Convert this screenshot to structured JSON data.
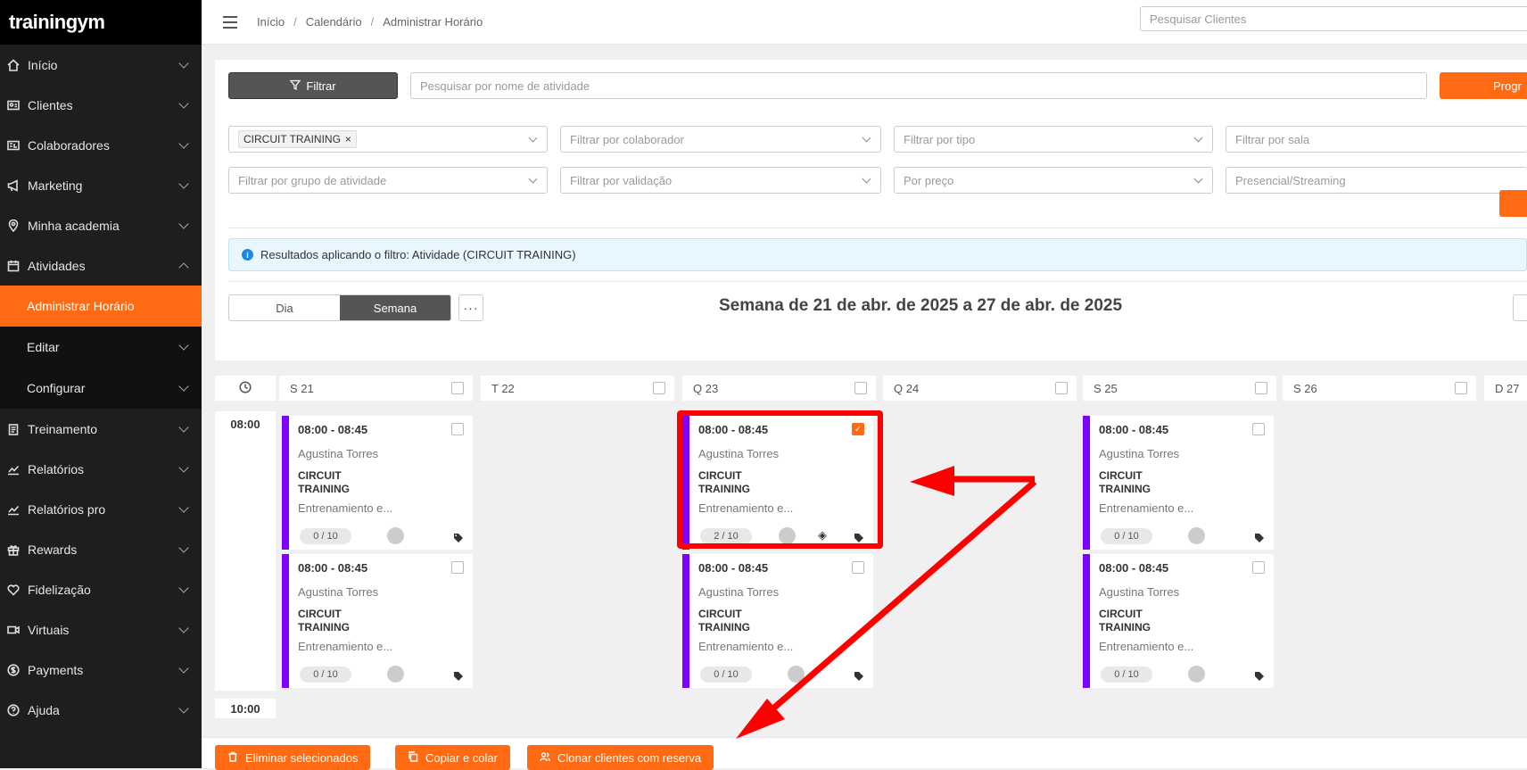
{
  "brand": {
    "logo": "trainingym"
  },
  "sidebar": {
    "items": [
      {
        "label": "Início",
        "icon": "home-icon"
      },
      {
        "label": "Clientes",
        "icon": "id-card-icon"
      },
      {
        "label": "Colaboradores",
        "icon": "badge-icon"
      },
      {
        "label": "Marketing",
        "icon": "megaphone-icon"
      },
      {
        "label": "Minha academia",
        "icon": "location-icon"
      },
      {
        "label": "Atividades",
        "icon": "calendar-icon"
      }
    ],
    "sub_items": [
      {
        "label": "Administrar Horário"
      },
      {
        "label": "Editar"
      },
      {
        "label": "Configurar"
      }
    ],
    "items_after": [
      {
        "label": "Treinamento",
        "icon": "clipboard-icon"
      },
      {
        "label": "Relatórios",
        "icon": "chart-icon"
      },
      {
        "label": "Relatórios pro",
        "icon": "chart-pro-icon"
      },
      {
        "label": "Rewards",
        "icon": "gift-icon"
      },
      {
        "label": "Fidelização",
        "icon": "heart-icon"
      },
      {
        "label": "Virtuais",
        "icon": "video-icon"
      },
      {
        "label": "Payments",
        "icon": "dollar-icon"
      },
      {
        "label": "Ajuda",
        "icon": "help-icon"
      }
    ]
  },
  "breadcrumb": {
    "items": [
      "Início",
      "Calendário",
      "Administrar Horário"
    ],
    "separator": "/"
  },
  "top_search": {
    "placeholder": "Pesquisar Clientes"
  },
  "filters": {
    "filter_button": "Filtrar",
    "activity_search_placeholder": "Pesquisar por nome de atividade",
    "program_button": "Progr",
    "activity_chip": "CIRCUIT TRAINING",
    "collaborator": "Filtrar por colaborador",
    "type": "Filtrar por tipo",
    "room": "Filtrar por sala",
    "activity_group": "Filtrar por grupo de atividade",
    "validation": "Filtrar por validação",
    "price": "Por preço",
    "mode": "Presencial/Streaming"
  },
  "info_banner": "Resultados aplicando o filtro: Atividade (CIRCUIT TRAINING)",
  "view": {
    "day": "Dia",
    "week": "Semana",
    "more": "···",
    "selected": "Semana"
  },
  "week_title": "Semana de 21 de abr. de 2025 a 27 de abr. de 2025",
  "calendar": {
    "days": [
      "S 21",
      "T 22",
      "Q 23",
      "Q 24",
      "S 25",
      "S 26",
      "D 27"
    ],
    "times": [
      "08:00",
      "10:00"
    ]
  },
  "class_card": {
    "time": "08:00 - 08:45",
    "instructor": "Agustina Torres",
    "name": "CIRCUIT TRAINING",
    "description": "Entrenamiento e...",
    "accent": "#7f00ff"
  },
  "cards": [
    {
      "count": "0 / 10",
      "checked": false
    },
    {
      "count": "0 / 10",
      "checked": false
    },
    {
      "count": "2 / 10",
      "checked": true
    },
    {
      "count": "0 / 10",
      "checked": false
    },
    {
      "count": "0 / 10",
      "checked": false
    },
    {
      "count": "0 / 10",
      "checked": false
    }
  ],
  "actions": {
    "delete": "Eliminar selecionados",
    "copy": "Copiar e colar",
    "clone": "Clonar clientes com reserva"
  },
  "colors": {
    "accent": "#ff6a13",
    "sidebar": "#1e1e1e",
    "annotation": "#ff0000"
  }
}
